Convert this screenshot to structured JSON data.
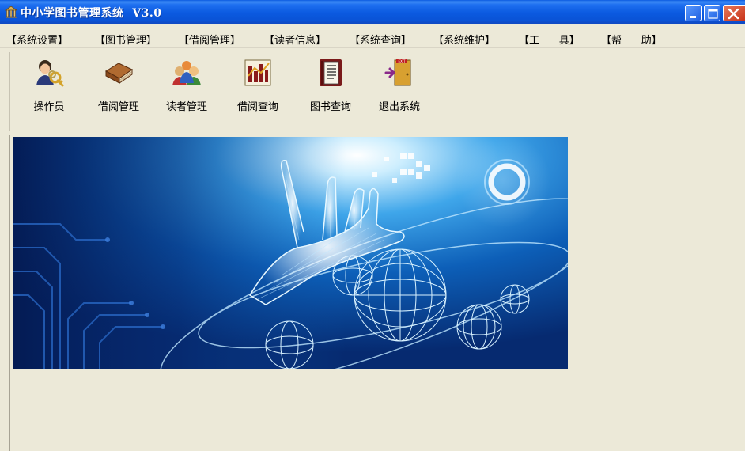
{
  "window": {
    "title": "中小学图书管理系统  V3.0",
    "title_bar_color": "#0b5ae0",
    "controls": [
      "minimize-icon",
      "maximize-icon",
      "close-icon"
    ]
  },
  "menu": {
    "items": [
      {
        "label": "【系统设置】"
      },
      {
        "label": "【图书管理】"
      },
      {
        "label": "【借阅管理】"
      },
      {
        "label": "【读者信息】"
      },
      {
        "label": "【系统查询】"
      },
      {
        "label": "【系统维护】"
      },
      {
        "label": "【工      具】"
      },
      {
        "label": "【帮      助】"
      }
    ]
  },
  "toolbar": {
    "buttons": [
      {
        "label": "操作员",
        "icon": "operator-keys-icon"
      },
      {
        "label": "借阅管理",
        "icon": "brown-book-icon"
      },
      {
        "label": "读者管理",
        "icon": "users-group-icon"
      },
      {
        "label": "借阅查询",
        "icon": "bar-chart-icon"
      },
      {
        "label": "图书查询",
        "icon": "open-book-icon"
      },
      {
        "label": "退出系统",
        "icon": "exit-door-icon"
      }
    ]
  },
  "banner": {
    "image": "tech-hand-globes-banner",
    "accent": "#0d5fb8"
  }
}
